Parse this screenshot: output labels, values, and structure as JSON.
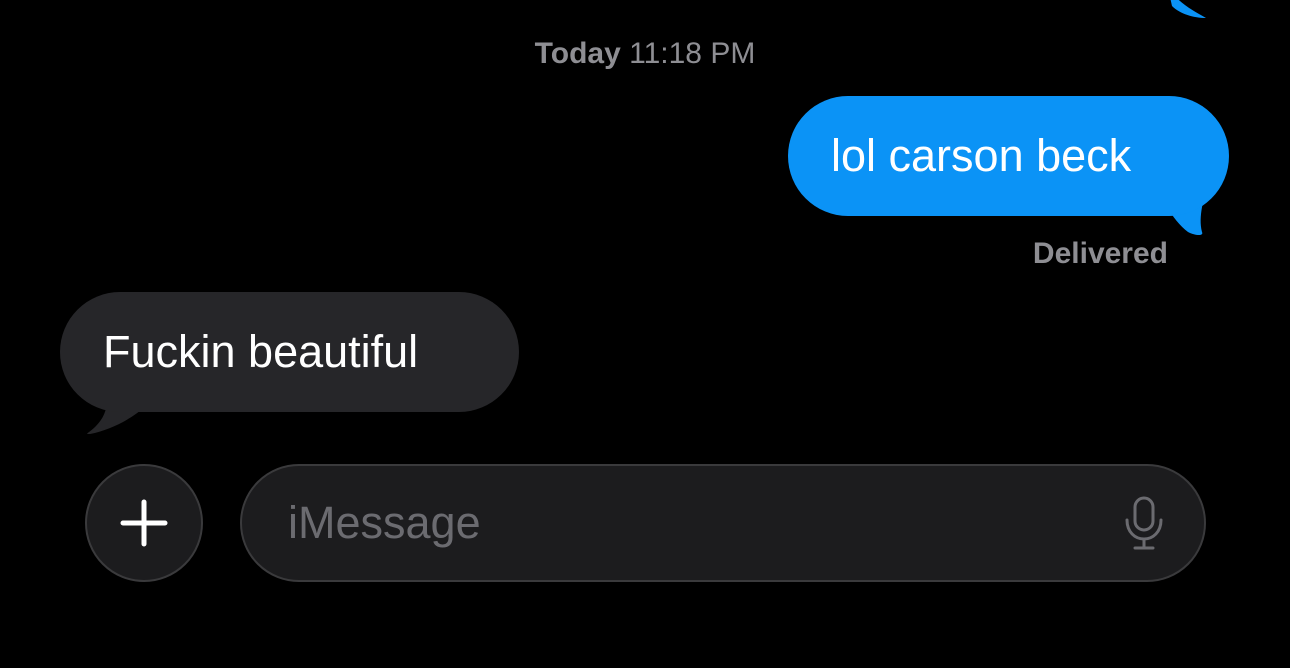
{
  "conversation": {
    "timestamp_day": "Today",
    "timestamp_time": "11:18 PM",
    "messages": [
      {
        "direction": "outgoing",
        "text": "lol carson beck"
      },
      {
        "direction": "incoming",
        "text": "Fuckin beautiful"
      }
    ],
    "delivery_status": "Delivered"
  },
  "composer": {
    "placeholder": "iMessage",
    "value": "",
    "plus_icon": "plus-icon",
    "mic_icon": "microphone-icon"
  },
  "colors": {
    "background": "#000000",
    "outgoing_bubble": "#0b93f6",
    "incoming_bubble": "#262629",
    "secondary_text": "#8e8e93"
  }
}
